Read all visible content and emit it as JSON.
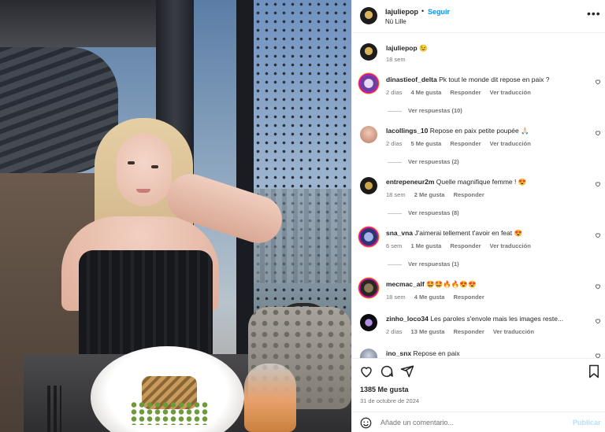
{
  "post": {
    "username": "lajuliepop",
    "dot": "•",
    "follow_label": "Seguir",
    "location": "Nü Lille",
    "more_icon": "more-options-icon",
    "caption_emoji": "😉",
    "caption_time": "18 sem"
  },
  "comments": [
    {
      "user": "dinastieof_delta",
      "text": "Pk tout le monde dit repose en paix ?",
      "time": "2 días",
      "likes": "4 Me gusta",
      "reply": "Responder",
      "translate": "Ver traducción",
      "replies": "Ver respuestas (10)"
    },
    {
      "user": "lacollings_10",
      "text": "Repose en paix petite poupée 🙏🏻",
      "time": "2 días",
      "likes": "5 Me gusta",
      "reply": "Responder",
      "translate": "Ver traducción",
      "replies": "Ver respuestas (2)"
    },
    {
      "user": "entrepeneur2m",
      "text": "Quelle magnifique femme ! 😍",
      "time": "18 sem",
      "likes": "2 Me gusta",
      "reply": "Responder",
      "translate": "",
      "replies": "Ver respuestas (8)"
    },
    {
      "user": "sna_vna",
      "text": "J'aimerai tellement t'avoir en feat 😍",
      "time": "6 sem",
      "likes": "1 Me gusta",
      "reply": "Responder",
      "translate": "Ver traducción",
      "replies": "Ver respuestas (1)"
    },
    {
      "user": "mecmac_alf",
      "text": "🤩🤩🔥🔥😍😍",
      "time": "18 sem",
      "likes": "4 Me gusta",
      "reply": "Responder",
      "translate": "",
      "replies": ""
    },
    {
      "user": "zinho_loco34",
      "text": "Les paroles s'envole mais les images reste...",
      "time": "2 días",
      "likes": "13 Me gusta",
      "reply": "Responder",
      "translate": "Ver traducción",
      "replies": ""
    },
    {
      "user": "ino_snx",
      "text": "Repose en paix",
      "time": "",
      "likes": "",
      "reply": "",
      "translate": "",
      "replies": ""
    }
  ],
  "actions": {
    "like_icon": "heart-icon",
    "comment_icon": "comment-icon",
    "share_icon": "share-icon",
    "save_icon": "bookmark-icon",
    "likes_count": "1385 Me gusta",
    "date": "31 de octubre de 2024"
  },
  "add_comment": {
    "emoji_icon": "emoji-icon",
    "placeholder": "Añade un comentario...",
    "publish_label": "Publicar"
  },
  "colors": {
    "link_blue": "#0095f6",
    "publish_disabled": "#b2dffc",
    "secondary_text": "#737373",
    "primary_text": "#262626"
  }
}
